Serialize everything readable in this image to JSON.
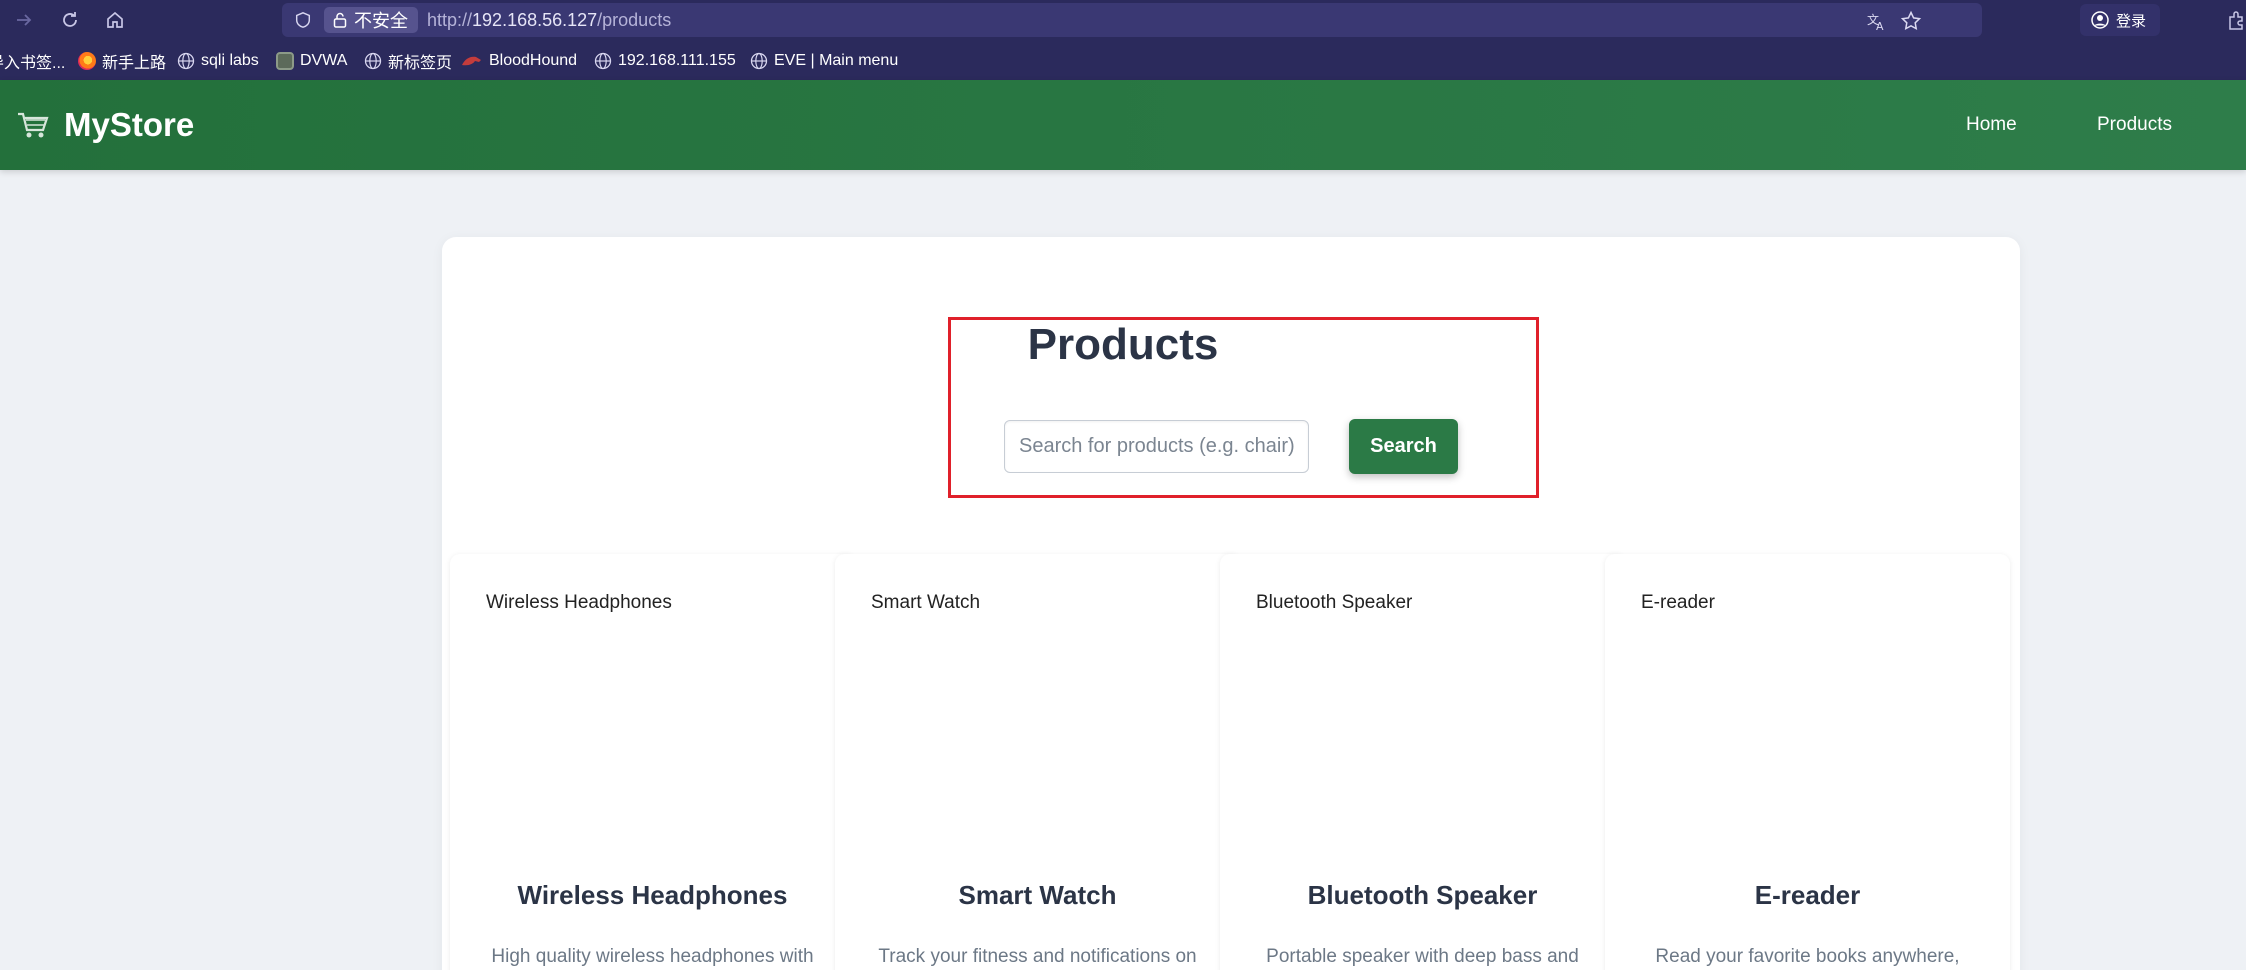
{
  "browser": {
    "security_label": "不安全",
    "url_prefix": "http://",
    "url_host": "192.168.56.127",
    "url_path": "/products",
    "login_label": "登录",
    "bookmarks": [
      {
        "label": "导入书签...",
        "icon": "folder-icon"
      },
      {
        "label": "新手上路",
        "icon": "firefox-icon"
      },
      {
        "label": "sqli labs",
        "icon": "globe-icon"
      },
      {
        "label": "DVWA",
        "icon": "dvwa-icon"
      },
      {
        "label": "新标签页",
        "icon": "globe-icon"
      },
      {
        "label": "BloodHound",
        "icon": "bloodhound-icon"
      },
      {
        "label": "192.168.111.155",
        "icon": "globe-icon"
      },
      {
        "label": "EVE | Main menu",
        "icon": "globe-icon"
      }
    ]
  },
  "site": {
    "brand": "MyStore",
    "nav": [
      "Home",
      "Products"
    ],
    "accent_color": "#2b7a46"
  },
  "page": {
    "title": "Products",
    "search_placeholder": "Search for products (e.g. chair)",
    "search_button": "Search"
  },
  "products": [
    {
      "image_alt": "Wireless Headphones",
      "name": "Wireless Headphones",
      "description": "High quality wireless headphones with"
    },
    {
      "image_alt": "Smart Watch",
      "name": "Smart Watch",
      "description": "Track your fitness and notifications on"
    },
    {
      "image_alt": "Bluetooth Speaker",
      "name": "Bluetooth Speaker",
      "description": "Portable speaker with deep bass and"
    },
    {
      "image_alt": "E-reader",
      "name": "E-reader",
      "description": "Read your favorite books anywhere,"
    }
  ]
}
